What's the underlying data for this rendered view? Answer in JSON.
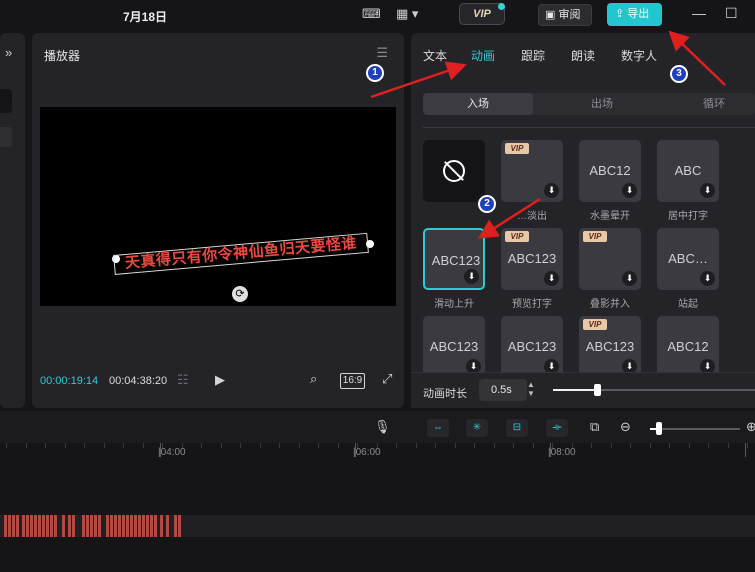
{
  "topbar": {
    "date": "7月18日",
    "vip_label": "VIP",
    "review_label": "审阅",
    "export_label": "导出",
    "icons": [
      "keyboard-icon",
      "layout-icon",
      "minimize-icon",
      "maximize-icon"
    ]
  },
  "left_panel": {
    "collapse_glyph": "»"
  },
  "player": {
    "title": "播放器",
    "subtitle_text": "天真得只有你令神仙鱼归天要怪谁",
    "current_time": "00:00:19:14",
    "total_time": "00:04:38:20",
    "ratio": "16:9"
  },
  "right_panel": {
    "tabs": [
      {
        "label": "文本",
        "active": false
      },
      {
        "label": "动画",
        "active": true
      },
      {
        "label": "跟踪",
        "active": false
      },
      {
        "label": "朗读",
        "active": false
      },
      {
        "label": "数字人",
        "active": false
      }
    ],
    "subtabs": [
      {
        "label": "入场",
        "active": true
      },
      {
        "label": "出场",
        "active": false
      },
      {
        "label": "循环",
        "active": false
      }
    ],
    "animations": [
      {
        "text": "",
        "label": "",
        "vip": false,
        "none": true
      },
      {
        "text": "",
        "label": "…淡出",
        "vip": true
      },
      {
        "text": "ABC12",
        "label": "水墨晕开",
        "vip": false
      },
      {
        "text": "ABC",
        "label": "居中打字",
        "vip": false
      },
      {
        "text": "ABC123",
        "label": "滑动上升",
        "vip": false,
        "selected": true
      },
      {
        "text": "ABC123",
        "label": "预览打字",
        "vip": true
      },
      {
        "text": "",
        "label": "叠影并入",
        "vip": true
      },
      {
        "text": "ABC…",
        "label": "站起",
        "vip": false
      },
      {
        "text": "ABC123",
        "label": "",
        "vip": false
      },
      {
        "text": "ABC123",
        "label": "",
        "vip": false
      },
      {
        "text": "ABC123",
        "label": "",
        "vip": true
      },
      {
        "text": "ABC12",
        "label": "",
        "vip": false
      }
    ],
    "duration_label": "动画时长",
    "duration_value": "0.5s",
    "duration_level": 0.22
  },
  "toolbar": {
    "tools": [
      "mic-icon",
      "link-icon",
      "freeze-icon",
      "link-tool-icon",
      "split-icon",
      "preview-icon",
      "zoom-out-icon",
      "zoom-in-icon"
    ]
  },
  "timeline": {
    "ruler": [
      "|04:00",
      "|06:00",
      "|08:00"
    ]
  },
  "annotations": [
    "1",
    "2",
    "3"
  ],
  "colors": {
    "accent": "#2fcad4",
    "export": "#22c6cf",
    "subtitle": "#e84a3f",
    "arrow": "#e02020",
    "badge": "#1f3fbf"
  }
}
